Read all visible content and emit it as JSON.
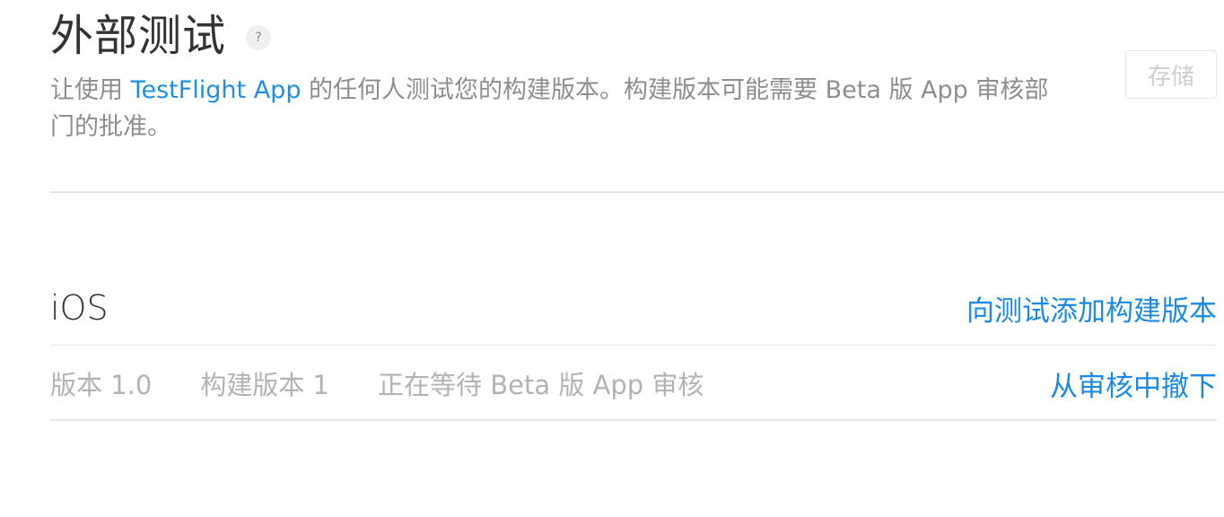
{
  "section": {
    "title": "外部测试",
    "help_icon": "question-icon",
    "help_glyph": "?",
    "save_label": "存储",
    "description_prefix": "让使用 ",
    "description_link": "TestFlight App",
    "description_suffix": " 的任何人测试您的构建版本。构建版本可能需要 Beta 版 App 审核部门的批准。"
  },
  "platform": {
    "name": "iOS",
    "add_build_label": "向测试添加构建版本"
  },
  "build": {
    "version": "版本 1.0",
    "build_number": "构建版本 1",
    "status": "正在等待 Beta 版 App 审核",
    "withdraw_label": "从审核中撤下"
  },
  "colors": {
    "link": "#1a8ae6",
    "muted_text": "#8e8e8e",
    "divider": "#e5e5e5"
  }
}
